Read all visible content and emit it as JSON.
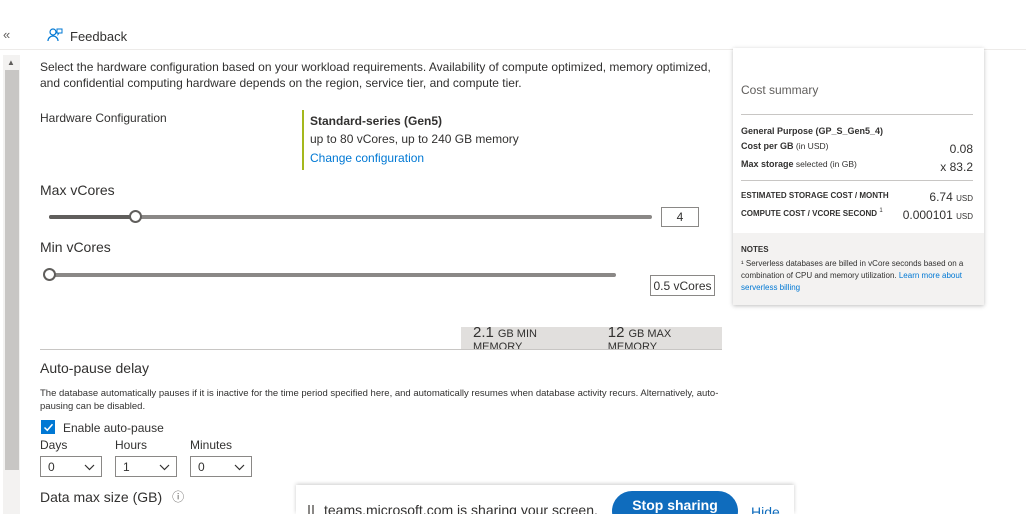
{
  "top": {
    "collapse_icon": "«",
    "feedback_label": "Feedback"
  },
  "intro": "Select the hardware configuration based on your workload requirements. Availability of compute optimized, memory optimized, and confidential computing hardware depends on the region, service tier, and compute tier.",
  "hardware": {
    "label": "Hardware Configuration",
    "title": "Standard-series (Gen5)",
    "subtitle": "up to 80 vCores, up to 240 GB memory",
    "change_link": "Change configuration"
  },
  "max_vcores": {
    "label": "Max vCores",
    "value": "4",
    "fraction": 0.143
  },
  "min_vcores": {
    "label": "Min vCores",
    "value": "0.5 vCores",
    "fraction": 0.0
  },
  "memory": {
    "min_value": "2.1",
    "min_label": "GB MIN MEMORY",
    "max_value": "12",
    "max_label": "GB MAX MEMORY"
  },
  "autopause": {
    "title": "Auto-pause delay",
    "description": "The database automatically pauses if it is inactive for the time period specified here, and automatically resumes when database activity recurs. Alternatively, auto-pausing can be disabled.",
    "enable_label": "Enable auto-pause",
    "days_label": "Days",
    "days_value": "0",
    "hours_label": "Hours",
    "hours_value": "1",
    "minutes_label": "Minutes",
    "minutes_value": "0"
  },
  "data_max": {
    "label": "Data max size (GB)",
    "info_icon": "ⓘ"
  },
  "cost": {
    "title": "Cost summary",
    "tier": "General Purpose (GP_S_Gen5_4)",
    "per_gb_label_bold": "Cost per GB",
    "per_gb_label_rest": " (in USD)",
    "per_gb_value": "0.08",
    "max_storage_bold": "Max storage",
    "max_storage_rest": " selected (in GB)",
    "max_storage_value": "x 83.2",
    "storage_cost_label": "ESTIMATED STORAGE COST / MONTH",
    "storage_cost_value": "6.74",
    "compute_cost_label": "COMPUTE COST / VCORE SECOND",
    "compute_cost_sup": "1",
    "compute_cost_value": "0.000101",
    "currency": "USD",
    "notes_title": "NOTES",
    "notes_text": "¹ Serverless databases are billed in vCore seconds based on a combination of CPU and memory utilization. ",
    "notes_link": "Learn more about serverless billing"
  },
  "share": {
    "text": "teams.microsoft.com is sharing your screen.",
    "stop_label": "Stop sharing",
    "hide_label": "Hide"
  },
  "colors": {
    "accent": "#0078d4",
    "hardware_border": "#a4b81d"
  }
}
